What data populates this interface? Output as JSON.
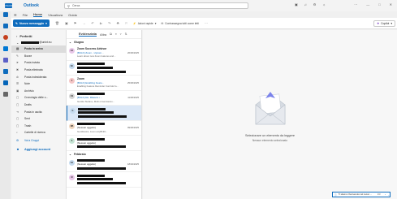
{
  "app": {
    "title": "Outlook",
    "logo_text": "OUTLOOK"
  },
  "search": {
    "placeholder": "Cerca"
  },
  "titlebar_icons": [
    "meet-icon",
    "bell-icon",
    "gear-icon",
    "lightbulb-icon"
  ],
  "tabs": [
    {
      "label": "File",
      "active": false
    },
    {
      "label": "Home",
      "active": true
    },
    {
      "label": "Visualizza",
      "active": false
    },
    {
      "label": "Guida",
      "active": false
    }
  ],
  "ribbon": {
    "new_message": "Nuovo messaggio",
    "quick_steps": "Azioni rapide",
    "mark_all_read": "Contrassegna tutti come letti",
    "copilot": "Copilot"
  },
  "folders": {
    "favorites_label": "Preferiti",
    "account_label": "@unint.eu",
    "items": [
      {
        "label": "Posta in arrivo",
        "icon": "inbox-icon",
        "selected": true
      },
      {
        "label": "Bozze",
        "icon": "draft-icon"
      },
      {
        "label": "Posta inviata",
        "icon": "send-icon"
      },
      {
        "label": "Posta eliminata",
        "icon": "trash-icon"
      },
      {
        "label": "Posta indesiderata",
        "icon": "junk-icon"
      },
      {
        "label": "Note",
        "icon": "note-icon"
      },
      {
        "label": "Archivio",
        "icon": "archive-icon"
      },
      {
        "label": "Cronologia delle c...",
        "icon": "folder-icon"
      },
      {
        "label": "Drafts",
        "icon": "folder-icon"
      },
      {
        "label": "Posta in uscita",
        "icon": "outbox-icon"
      },
      {
        "label": "Sent",
        "icon": "folder-icon"
      },
      {
        "label": "Trash",
        "icon": "folder-icon"
      },
      {
        "label": "Cartelle di ricerca",
        "icon": "search-folder-icon"
      }
    ],
    "groups_label": "Vai a Gruppi",
    "add_account": "Aggiungi account"
  },
  "mail_list": {
    "tab_focused": "Evidenziata",
    "tab_other": "Altra",
    "groups": [
      {
        "label": "Giugno",
        "mails": [
          {
            "initials": "ZA",
            "avatar_color": "#e8c7e8",
            "sender": "Zoom Success Advisor",
            "subject": "[BULK] Zoom - Upcom...",
            "date": "26/06/2025",
            "preview": "Learn about new Zoom features and...",
            "selected": false,
            "subject_blue": true
          },
          {
            "initials": "SC",
            "avatar_color": "#c7dcf0",
            "sender": "",
            "subject": "",
            "date": "",
            "preview": "",
            "selected": false,
            "subject_blue": false
          },
          {
            "initials": "Z",
            "avatar_color": "#f5c6c6",
            "sender": "Zoom",
            "subject": "[BULK] Enabling Featu...",
            "date": "25/06/2025",
            "preview": "Enabling Feature Reminder Controls fo...",
            "selected": false,
            "subject_blue": true
          },
          {
            "initials": "CS",
            "avatar_color": "#d6d6d6",
            "sender": "",
            "subject": "[BULK] Re: Rilascio i ...",
            "date": "11/06/2025",
            "preview": "Gentile Stefano, Molti ormai stanno...",
            "selected": false,
            "subject_blue": true
          },
          {
            "initials": "G",
            "avatar_color": "#c7dcf0",
            "sender": "",
            "subject": "",
            "date": "",
            "preview": "",
            "selected": true,
            "subject_blue": false
          },
          {
            "initials": "NB",
            "avatar_color": "#f0d7c0",
            "sender": "",
            "subject": "(Nessun oggetto)",
            "date": "09/06/2025",
            "preview": "Gentilissimi, zoom.us/j/8193...",
            "selected": false,
            "subject_blue": false
          },
          {
            "initials": "S",
            "avatar_color": "#c7e6d6",
            "sender": "",
            "subject": "(Nessun oggetto)",
            "date": "",
            "preview": "",
            "selected": false,
            "subject_blue": false
          }
        ]
      },
      {
        "label": "Febbraio",
        "mails": [
          {
            "initials": "SA",
            "avatar_color": "#c7dcf0",
            "sender": "",
            "subject": "(Nessun oggetto)",
            "date": "18/02/2025",
            "preview": "",
            "selected": false,
            "subject_blue": false
          },
          {
            "initials": "M",
            "avatar_color": "#e8c7e8",
            "sender": "",
            "subject": "",
            "date": "",
            "preview": "",
            "selected": false,
            "subject_blue": false
          }
        ]
      }
    ]
  },
  "reading_pane": {
    "title": "Selezionare un elemento da leggere",
    "subtitle": "Nessun elemento selezionato"
  },
  "toast": {
    "text": "Ti stiamo il benvenuto nel nuovo ...",
    "page": "1/3"
  }
}
